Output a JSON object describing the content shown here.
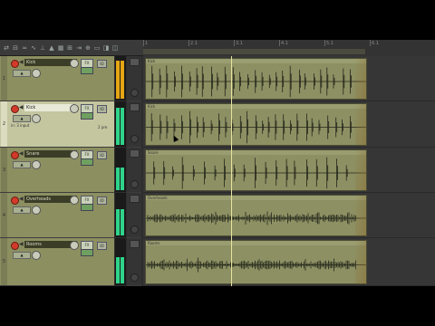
{
  "toolbar": {
    "buttons": [
      {
        "name": "route-icon",
        "glyph": "⇄"
      },
      {
        "name": "io-icon",
        "glyph": "⊟"
      },
      {
        "name": "env-icon",
        "glyph": "≈"
      },
      {
        "name": "fx-icon",
        "glyph": "∿"
      },
      {
        "name": "trim-icon",
        "glyph": "⊥"
      },
      {
        "name": "lock-icon",
        "glyph": "▲"
      },
      {
        "name": "grid-icon",
        "glyph": "▦"
      },
      {
        "name": "snap-icon",
        "glyph": "⊞"
      },
      {
        "name": "ripple-icon",
        "glyph": "⇥"
      },
      {
        "name": "group-icon",
        "glyph": "⊕"
      },
      {
        "name": "item-icon",
        "glyph": "▭"
      },
      {
        "name": "marker-icon",
        "glyph": "◨"
      },
      {
        "name": "region-icon",
        "glyph": "◫"
      }
    ]
  },
  "tracks": [
    {
      "num": "1",
      "name": "Kick",
      "selected": false,
      "fx_label": "FX",
      "io_label": "IO",
      "meter_color": "#e5a614",
      "meter_level": 0.92,
      "item_label": "Kick",
      "color": "#8c8f60"
    },
    {
      "num": "2",
      "name": "Kick",
      "selected": true,
      "fx_label": "FX",
      "io_label": "IO",
      "info_left": "in: 3 input",
      "info_right": "2 pre",
      "meter_color": "#2ed48a",
      "meter_level": 0.88,
      "item_label": "Kick",
      "color": "#c4c6a0"
    },
    {
      "num": "3",
      "name": "Snare",
      "selected": false,
      "fx_label": "FX",
      "io_label": "IO",
      "meter_color": "#2ed48a",
      "meter_level": 0.55,
      "item_label": "Snare",
      "color": "#8c8f60"
    },
    {
      "num": "4",
      "name": "Overheads",
      "selected": false,
      "fx_label": "FX",
      "io_label": "IO",
      "meter_color": "#2ed48a",
      "meter_level": 0.62,
      "item_label": "Overheads",
      "color": "#8c8f60"
    },
    {
      "num": "5",
      "name": "Rooms",
      "selected": false,
      "fx_label": "FX",
      "io_label": "IO",
      "meter_color": "#2ed48a",
      "meter_level": 0.6,
      "item_label": "Rooms",
      "color": "#8c8f60"
    }
  ],
  "ruler": {
    "labels": [
      "1",
      "2.1",
      "3.1",
      "4.1",
      "5.1",
      "6.1"
    ]
  },
  "colors": {
    "item": "#8d9063",
    "waveform": "#24261a",
    "edit_cursor": "#e8e4a0",
    "record_arm": "#d23a2a"
  }
}
